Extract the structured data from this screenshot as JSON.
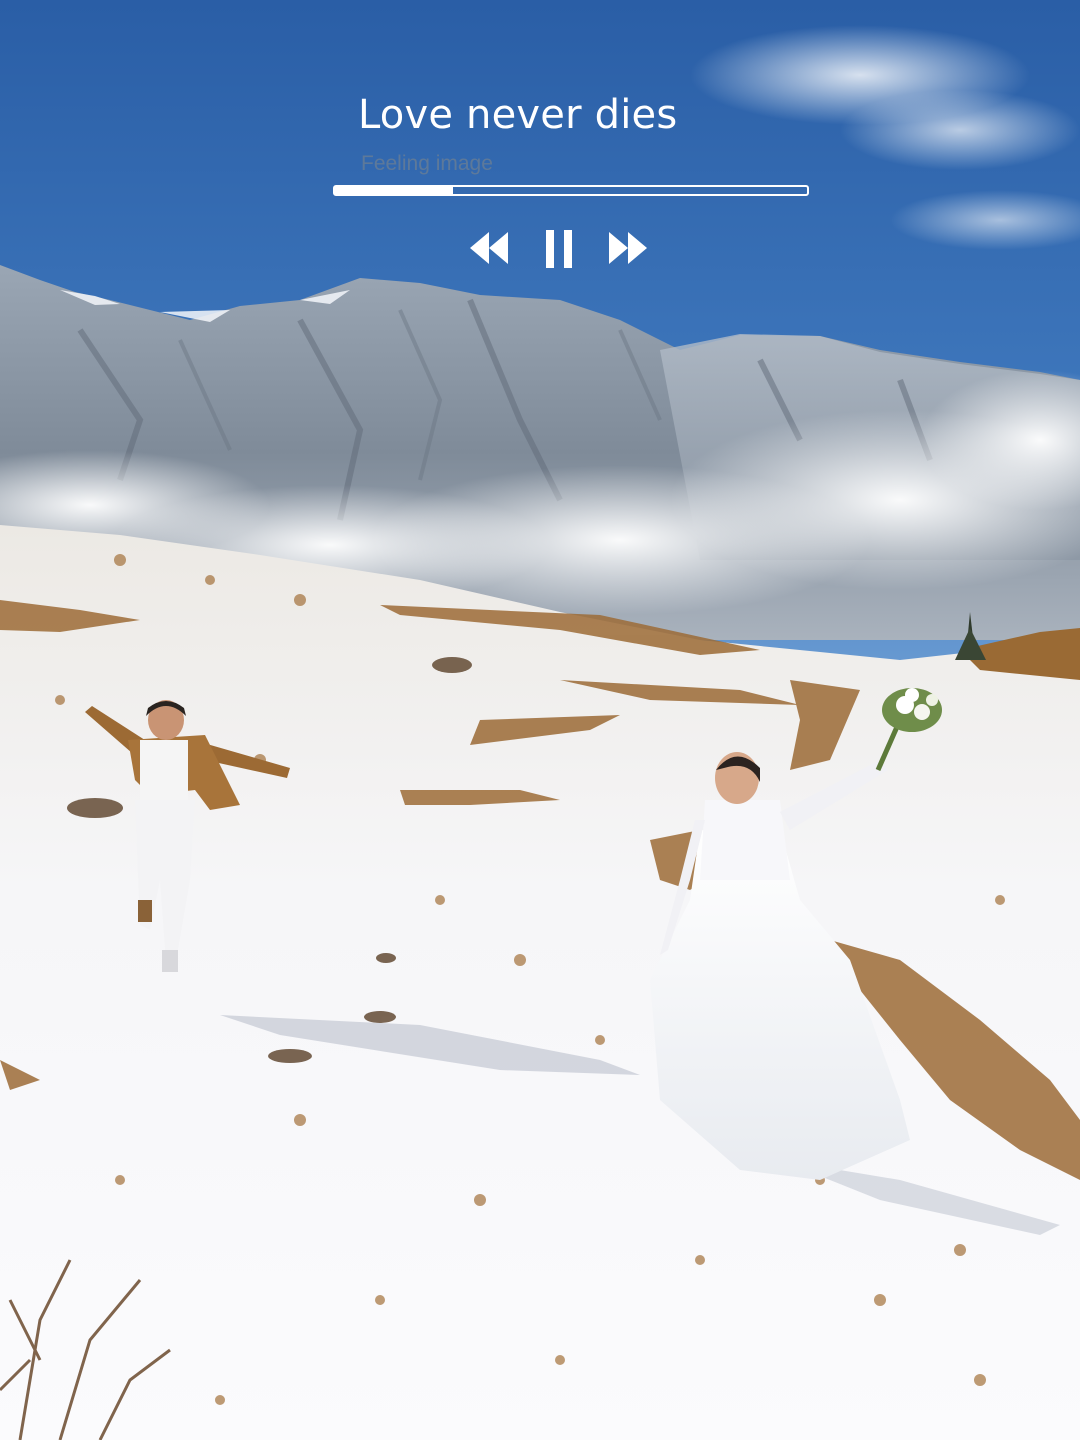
{
  "player": {
    "title": "Love never dies",
    "subtitle": "Feeling image",
    "progress": 0.25,
    "controls": {
      "rewind_icon": "rewind-icon",
      "pause_icon": "pause-icon",
      "forward_icon": "fast-forward-icon"
    },
    "accent_color": "#ffffff"
  }
}
